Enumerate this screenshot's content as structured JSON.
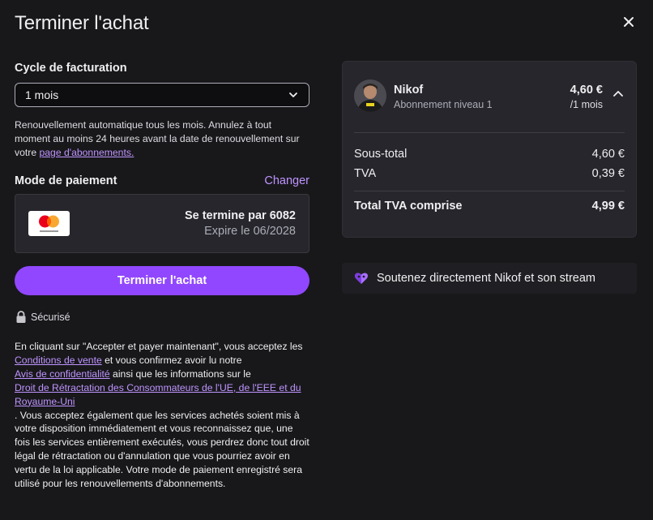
{
  "modal": {
    "title": "Terminer l'achat",
    "close_icon": "close-icon"
  },
  "billing": {
    "label": "Cycle de facturation",
    "selected": "1 mois",
    "renewal_text": "Renouvellement automatique tous les mois. Annulez à tout moment au moins 24 heures avant la date de renouvellement sur votre ",
    "renewal_link": "page d'abonnements."
  },
  "payment": {
    "label": "Mode de paiement",
    "change_label": "Changer",
    "card_brand_icon": "mastercard-icon",
    "card_ends": "Se termine par 6082",
    "card_expiry": "Expire le 06/2028"
  },
  "actions": {
    "complete_label": "Terminer l'achat",
    "secure_label": "Sécurisé"
  },
  "legal": {
    "part1": "En cliquant sur \"Accepter et payer maintenant\", vous acceptez les ",
    "link_terms": "Conditions de vente",
    "part2": " et vous confirmez avoir lu notre ",
    "link_privacy": "Avis de confidentialité",
    "part3": " ainsi que les informations sur le ",
    "link_withdrawal": "Droit de Rétractation des Consommateurs de l'UE, de l'EEE et du Royaume-Uni",
    "part4": ". Vous acceptez également que les services achetés soient mis à votre disposition immédiatement et vous reconnaissez que, une fois les services entièrement exécutés, vous perdrez donc tout droit légal de rétractation ou d'annulation que vous pourriez avoir en vertu de la loi applicable. Votre mode de paiement enregistré sera utilisé pour les renouvellements d'abonnements."
  },
  "summary": {
    "streamer": "Nikof",
    "tier": "Abonnement niveau 1",
    "price": "4,60 €",
    "period": "/1 mois",
    "subtotal_label": "Sous-total",
    "subtotal_value": "4,60 €",
    "vat_label": "TVA",
    "vat_value": "0,39 €",
    "total_label": "Total TVA comprise",
    "total_value": "4,99 €"
  },
  "support": {
    "icon": "heart-gem-icon",
    "text": "Soutenez directement Nikof et son stream"
  },
  "colors": {
    "accent": "#9147ff",
    "link": "#bf94ff",
    "background": "#18181b",
    "panel": "#26262c"
  }
}
